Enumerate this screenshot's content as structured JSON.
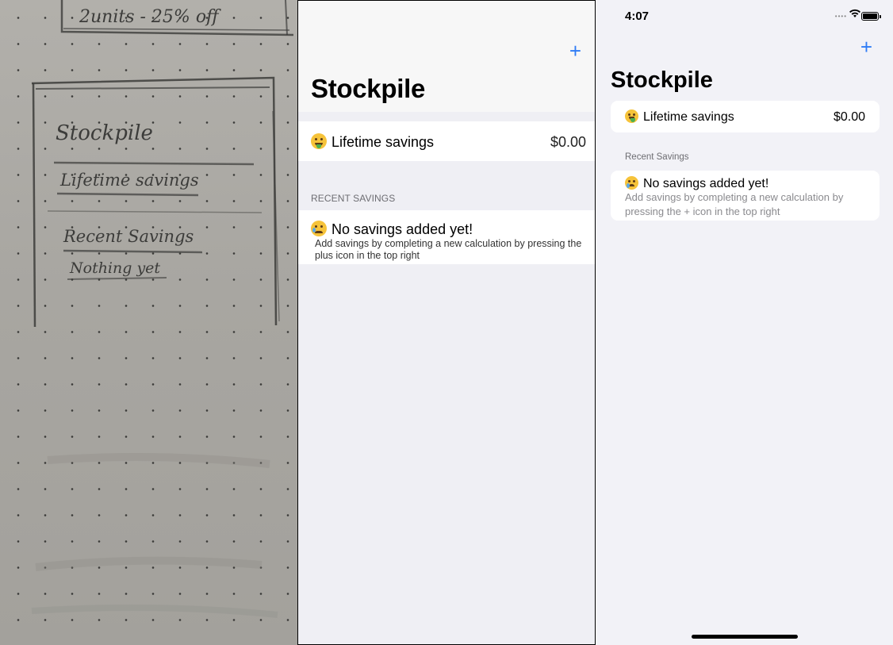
{
  "sketch": {
    "top_note": "2units - 25% off",
    "title": "Stockpile",
    "lifetime": "Lifetime savings",
    "recent": "Recent Savings",
    "nothing": "Nothing yet"
  },
  "screen_middle": {
    "title": "Stockpile",
    "add_icon": "+",
    "lifetime_label": "Lifetime savings",
    "lifetime_value": "$0.00",
    "section_header": "RECENT SAVINGS",
    "empty_title": "No savings added yet!",
    "empty_subtitle": "Add savings by completing a new calculation by pressing the plus icon in the top right"
  },
  "screen_right": {
    "status_time": "4:07",
    "title": "Stockpile",
    "add_icon": "+",
    "lifetime_label": "Lifetime savings",
    "lifetime_value": "$0.00",
    "section_header": "Recent Savings",
    "empty_title": "No savings added yet!",
    "empty_subtitle": "Add savings by completing a new calculation by pressing the + icon in the top right"
  },
  "colors": {
    "accent": "#2f7cf6",
    "grouped_background": "#f2f2f7"
  },
  "icons": [
    "money-mouth-face-icon",
    "crying-face-icon",
    "plus-icon",
    "wifi-icon",
    "battery-icon"
  ]
}
